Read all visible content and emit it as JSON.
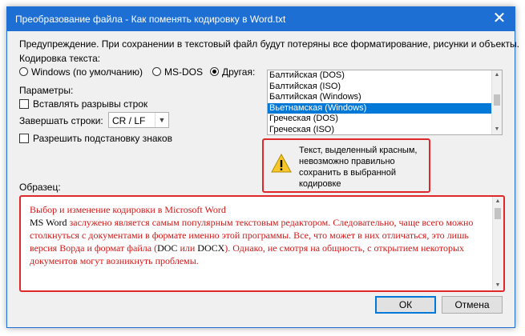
{
  "window": {
    "title": "Преобразование файла - Как поменять кодировку в Word.txt",
    "close_glyph": "✕"
  },
  "warning_line": "Предупреждение. При сохранении в текстовый файл будут потеряны все форматирование, рисунки и объекты.",
  "encoding": {
    "label": "Кодировка текста:",
    "options": [
      {
        "label": "Windows (по умолчанию)",
        "selected": false
      },
      {
        "label": "MS-DOS",
        "selected": false
      },
      {
        "label": "Другая:",
        "selected": true
      }
    ],
    "list": [
      "Балтийская (DOS)",
      "Балтийская (ISO)",
      "Балтийская (Windows)",
      "Вьетнамская (Windows)",
      "Греческая (DOS)",
      "Греческая (ISO)"
    ],
    "selected_item": "Вьетнамская (Windows)"
  },
  "params": {
    "label": "Параметры:",
    "insert_breaks": "Вставлять разрывы строк",
    "end_lines_label": "Завершать строки:",
    "end_lines_value": "CR / LF",
    "allow_subst": "Разрешить подстановку знаков"
  },
  "warning_box": {
    "icon": "warning-icon",
    "text": "Текст, выделенный красным, невозможно правильно сохранить в выбранной кодировке"
  },
  "sample": {
    "label": "Образец:",
    "line1": "Выбор и изменение кодировки в Microsoft Word",
    "line2": "MS Word",
    "line2_rest": " заслужено является самым популярным текстовым редактором. Следовательно, чаще всего можно столкнуться с документами в формате именно этой программы. Все, что может в них отличаться, это лишь версия Ворда и формат файла (",
    "doc": "DOC",
    "or": " или ",
    "docx": "DOCX",
    "tail": "). Однако, не смотря на общность, с открытием некоторых документов могут возникнуть проблемы."
  },
  "buttons": {
    "ok": "ОК",
    "cancel": "Отмена"
  },
  "colors": {
    "title_bar": "#1e6fd3",
    "highlight": "#e0272a",
    "selection": "#0078d7"
  }
}
